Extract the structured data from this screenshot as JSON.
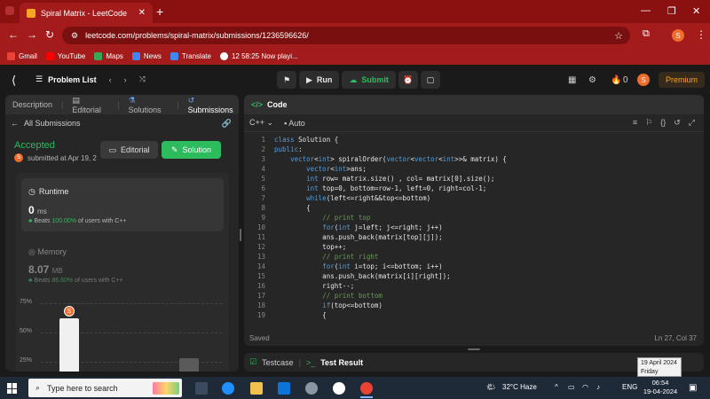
{
  "browser": {
    "tab_title": "Spiral Matrix - LeetCode",
    "tab_close": "✕",
    "new_tab": "+",
    "url": "leetcode.com/problems/spiral-matrix/submissions/1236596626/",
    "profile_initial": "S",
    "bookmarks": [
      "Gmail",
      "YouTube",
      "Maps",
      "News",
      "Translate",
      "12 58:25 Now playi..."
    ]
  },
  "nav": {
    "problem_list": "Problem List",
    "run": "Run",
    "submit": "Submit",
    "coins": "0",
    "avatar_initial": "S",
    "premium": "Premium"
  },
  "left": {
    "tabs": [
      "Description",
      "Editorial",
      "Solutions",
      "Submissions"
    ],
    "all_submissions": "All Submissions",
    "status": "Accepted",
    "submitted": "submitted at Apr 19, 2",
    "editorial_btn": "Editorial",
    "solution_btn": "Solution",
    "runtime": {
      "label": "Runtime",
      "value": "0",
      "unit": "ms",
      "beats_prefix": "Beats",
      "beats_pct": "100.00%",
      "beats_suffix": "of users with C++"
    },
    "memory": {
      "label": "Memory",
      "value": "8.07",
      "unit": "MB",
      "beats_prefix": "Beats",
      "beats_pct": "86.60%",
      "beats_suffix": "of users with C++"
    },
    "chart_labels": [
      "75%",
      "50%",
      "25%"
    ],
    "chart_avatar": "S"
  },
  "code": {
    "header": "Code",
    "language": "C++",
    "auto": "Auto",
    "lines": [
      {
        "n": "1",
        "parts": [
          [
            "kw",
            "class "
          ],
          [
            "tx",
            "Solution {"
          ]
        ]
      },
      {
        "n": "2",
        "parts": [
          [
            "kw",
            "public"
          ],
          [
            "tx",
            ":"
          ]
        ]
      },
      {
        "n": "3",
        "parts": [
          [
            "tx",
            "    "
          ],
          [
            "kw",
            "vector"
          ],
          [
            "tx",
            "<"
          ],
          [
            "kw",
            "int"
          ],
          [
            "tx",
            "> spiralOrder("
          ],
          [
            "kw",
            "vector"
          ],
          [
            "tx",
            "<"
          ],
          [
            "kw",
            "vector"
          ],
          [
            "tx",
            "<"
          ],
          [
            "kw",
            "int"
          ],
          [
            "tx",
            ">>& matrix) {"
          ]
        ]
      },
      {
        "n": "4",
        "parts": [
          [
            "tx",
            "        "
          ],
          [
            "kw",
            "vector"
          ],
          [
            "tx",
            "<"
          ],
          [
            "kw",
            "int"
          ],
          [
            "tx",
            ">ans;"
          ]
        ]
      },
      {
        "n": "5",
        "parts": [
          [
            "tx",
            "        "
          ],
          [
            "kw",
            "int"
          ],
          [
            "tx",
            " row= matrix.size() , col= matrix[0].size();"
          ]
        ]
      },
      {
        "n": "6",
        "parts": [
          [
            "tx",
            "        "
          ],
          [
            "kw",
            "int"
          ],
          [
            "tx",
            " top=0, bottom=row-1, left=0, right=col-1;"
          ]
        ]
      },
      {
        "n": "7",
        "parts": [
          [
            "tx",
            "        "
          ],
          [
            "kw",
            "while"
          ],
          [
            "tx",
            "(left<=right&&top<=bottom)"
          ]
        ]
      },
      {
        "n": "8",
        "parts": [
          [
            "tx",
            "        {"
          ]
        ]
      },
      {
        "n": "9",
        "parts": [
          [
            "tx",
            "            "
          ],
          [
            "cm",
            "// print top"
          ]
        ]
      },
      {
        "n": "10",
        "parts": [
          [
            "tx",
            "            "
          ],
          [
            "kw",
            "for"
          ],
          [
            "tx",
            "("
          ],
          [
            "kw",
            "int"
          ],
          [
            "tx",
            " j=left; j<=right; j++)"
          ]
        ]
      },
      {
        "n": "11",
        "parts": [
          [
            "tx",
            "            ans.push_back(matrix[top][j]);"
          ]
        ]
      },
      {
        "n": "12",
        "parts": [
          [
            "tx",
            "            top++;"
          ]
        ]
      },
      {
        "n": "13",
        "parts": [
          [
            "tx",
            "            "
          ],
          [
            "cm",
            "// print right"
          ]
        ]
      },
      {
        "n": "14",
        "parts": [
          [
            "tx",
            "            "
          ],
          [
            "kw",
            "for"
          ],
          [
            "tx",
            "("
          ],
          [
            "kw",
            "int"
          ],
          [
            "tx",
            " i=top; i<=bottom; i++)"
          ]
        ]
      },
      {
        "n": "15",
        "parts": [
          [
            "tx",
            "            ans.push_back(matrix[i][right]);"
          ]
        ]
      },
      {
        "n": "16",
        "parts": [
          [
            "tx",
            "            right--;"
          ]
        ]
      },
      {
        "n": "17",
        "parts": [
          [
            "tx",
            "            "
          ],
          [
            "cm",
            "// print bottom"
          ]
        ]
      },
      {
        "n": "18",
        "parts": [
          [
            "tx",
            "            "
          ],
          [
            "kw",
            "if"
          ],
          [
            "tx",
            "(top<=bottom)"
          ]
        ]
      },
      {
        "n": "19",
        "parts": [
          [
            "tx",
            "            {"
          ]
        ]
      }
    ],
    "saved": "Saved",
    "cursor": "Ln 27, Col 37"
  },
  "test": {
    "testcase": "Testcase",
    "result": "Test Result"
  },
  "tooltip": {
    "date": "19 April 2024",
    "day": "Friday"
  },
  "taskbar": {
    "search_placeholder": "Type here to search",
    "weather": "32°C  Haze",
    "lang": "ENG",
    "time": "06:54",
    "date": "19-04-2024"
  },
  "colors": {
    "chrome_red": "#a31b1b",
    "accent_green": "#2cbb5d",
    "premium_orange": "#ffa116"
  }
}
